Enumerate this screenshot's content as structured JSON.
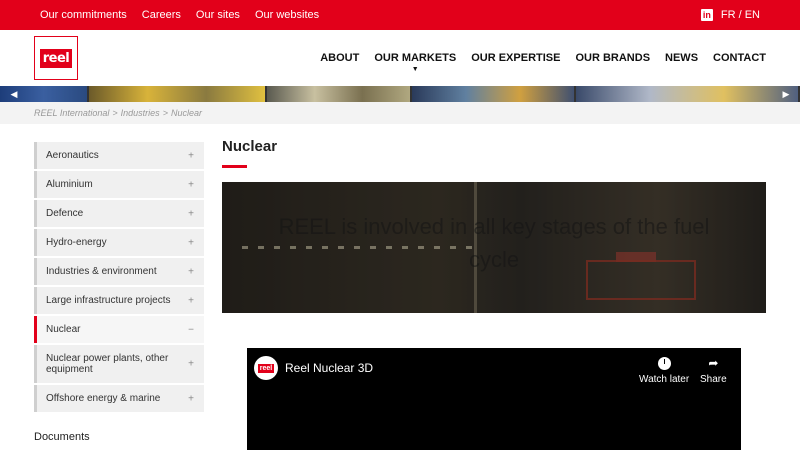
{
  "topbar": {
    "links": [
      "Our commitments",
      "Careers",
      "Our sites",
      "Our websites"
    ],
    "linkedin_icon": "linkedin-icon",
    "lang_fr": "FR",
    "lang_sep": "/",
    "lang_en": "EN"
  },
  "header": {
    "logo_text": "reel",
    "nav": [
      "ABOUT",
      "OUR MARKETS",
      "OUR EXPERTISE",
      "OUR BRANDS",
      "NEWS",
      "CONTACT"
    ],
    "caret": "▼"
  },
  "breadcrumb": [
    "REEL International",
    "Industries",
    "Nuclear"
  ],
  "breadcrumb_sep": ">",
  "sidebar": {
    "items": [
      {
        "label": "Aeronautics",
        "toggle": "+"
      },
      {
        "label": "Aluminium",
        "toggle": "+"
      },
      {
        "label": "Defence",
        "toggle": "+"
      },
      {
        "label": "Hydro-energy",
        "toggle": "+"
      },
      {
        "label": "Industries & environment",
        "toggle": "+"
      },
      {
        "label": "Large infrastructure projects",
        "toggle": "+"
      },
      {
        "label": "Nuclear",
        "toggle": "−"
      },
      {
        "label": "Nuclear power plants, other equipment",
        "toggle": "+"
      },
      {
        "label": "Offshore energy & marine",
        "toggle": "+"
      }
    ],
    "documents_label": "Documents"
  },
  "main": {
    "title": "Nuclear",
    "hero_text": "REEL is involved in all key stages of the fuel cycle"
  },
  "video": {
    "logo_text": "reel",
    "title": "Reel Nuclear 3D",
    "watch_later": "Watch later",
    "share": "Share"
  },
  "colors": {
    "brand_red": "#e2001a"
  }
}
